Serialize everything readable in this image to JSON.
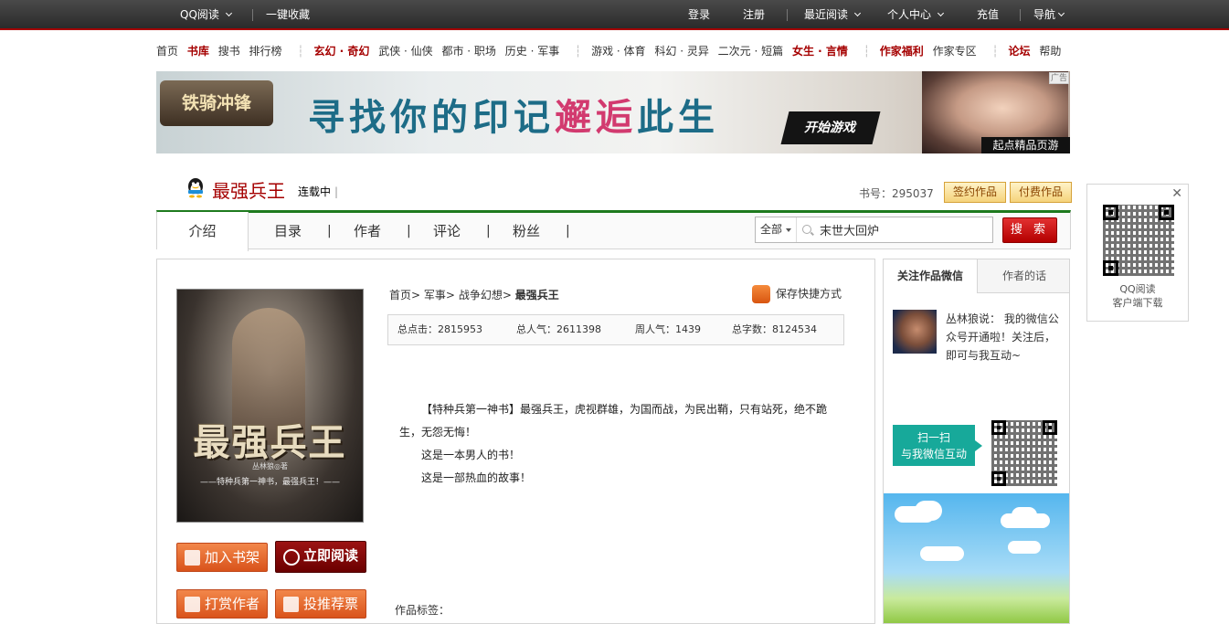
{
  "topbar": {
    "qq_read": "QQ阅读",
    "bookmark": "一键收藏",
    "login": "登录",
    "register": "注册",
    "recent": "最近阅读",
    "personal": "个人中心",
    "recharge": "充值",
    "nav": "导航"
  },
  "mainnav": {
    "items": [
      "首页",
      "书库",
      "搜书",
      "排行榜",
      "玄幻 · 奇幻",
      "武侠 · 仙侠",
      "都市 · 职场",
      "历史 · 军事",
      "游戏 · 体育",
      "科幻 · 灵异",
      "二次元 · 短篇",
      "女生 · 言情",
      "作家福利",
      "作家专区",
      "论坛",
      "帮助"
    ]
  },
  "banner": {
    "logo_text": "铁骑冲锋",
    "slogan_a": "寻找你的印记",
    "slogan_b": "邂逅",
    "slogan_c": "此生",
    "play": "开始游戏",
    "ad_tag": "广告",
    "page_game": "起点精品页游"
  },
  "book": {
    "title": "最强兵王",
    "status": "连载中",
    "status_bar": "|",
    "number": "书号：295037",
    "tag_signed": "签约作品",
    "tag_paid": "付费作品"
  },
  "tabs": {
    "intro": "介绍",
    "catalog": "目录",
    "author": "作者",
    "comment": "评论",
    "fans": "粉丝",
    "pipe": "|"
  },
  "search": {
    "scope": "全部",
    "value": "末世大回炉",
    "button": "搜 索"
  },
  "cover": {
    "title": "最强兵王",
    "tag": "丛林狼◎著",
    "sub": "——特种兵第一神书，最强兵王！——"
  },
  "buttons": {
    "add_shelf": "加入书架",
    "read_now": "立即阅读",
    "tip_author": "打赏作者",
    "vote": "投推荐票"
  },
  "breadcrumb": {
    "home": "首页",
    "cat1": "军事",
    "cat2": "战争幻想",
    "current": "最强兵王",
    "sep": ">"
  },
  "shortcut": "保存快捷方式",
  "stats": {
    "clicks": "总点击：2815953",
    "popularity": "总人气：2611398",
    "weekly": "周人气：1439",
    "words": "总字数：8124534"
  },
  "intro": {
    "p1": "【特种兵第一神书】最强兵王，虎视群雄，为国而战，为民出鞘，只有站死，绝不跪生，无怨无悔！",
    "p2": "这是一本男人的书！",
    "p3": "这是一部热血的故事！"
  },
  "tags_label": "作品标签：",
  "side": {
    "tab_wechat": "关注作品微信",
    "tab_author_words": "作者的话",
    "author_message": "丛林狼说： 我的微信公众号开通啦！关注后，即可与我互动~",
    "scan_line1": "扫一扫",
    "scan_line2": "与我微信互动"
  },
  "float_qr": {
    "close": "✕",
    "line1": "QQ阅读",
    "line2": "客户端下载"
  }
}
